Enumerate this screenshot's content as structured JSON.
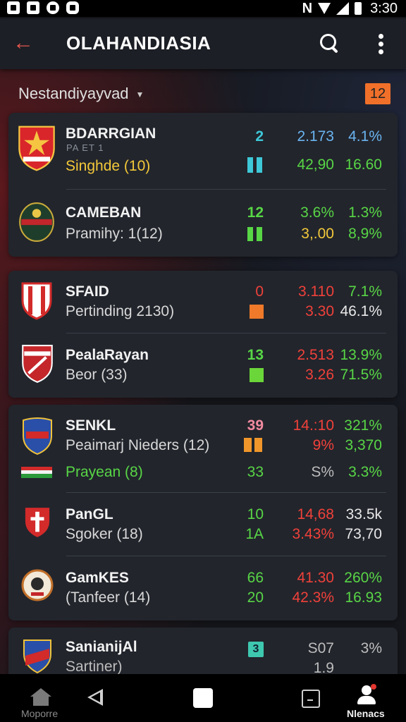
{
  "status_bar": {
    "time": "3:30",
    "carrier_glyph": "N",
    "icons": [
      "notification-icon",
      "file-icon",
      "voicemail-icon",
      "sim-icon",
      "signal-icon",
      "wifi-icon",
      "battery-icon"
    ]
  },
  "app_bar": {
    "title": "OLAHANDIASIA",
    "back_icon": "arrow-left-icon",
    "search_icon": "search-icon",
    "menu_icon": "more-vert-icon"
  },
  "filter": {
    "label": "Nestandiyayvad",
    "badge": "12"
  },
  "colors": {
    "accent": "#e4554e",
    "badge": "#f0702a",
    "green": "#58d646",
    "red": "#f0413a",
    "cyan": "#3ec8d8"
  },
  "cards": [
    {
      "rows": [
        {
          "name": "BDARRGIAN",
          "faint": "PA ET 1",
          "sub": "Singhde (10)",
          "v1a": "2",
          "v1b_marker": "cyan-bars",
          "v2a": "2.173",
          "v2b": "42,90",
          "v3a": "4.1%",
          "v3b": "16.60"
        },
        {
          "name": "CAMEBAN",
          "sub": "Pramihy: 1(12)",
          "v1a": "12",
          "v1b_marker": "green-bars",
          "v2a": "3.6%",
          "v2b": "3,.00",
          "v3a": "1.3%",
          "v3b": "8,9%"
        }
      ]
    },
    {
      "rows": [
        {
          "name": "SFAID",
          "sub": "Pertinding 2130)",
          "v1a": "0",
          "v1b_marker": "orange-square",
          "v2a": "3.110",
          "v2b": "3.30",
          "v3a": "7.1%",
          "v3b": "46.1%"
        },
        {
          "name": "PealaRayan",
          "sub": "Beor (33)",
          "v1a": "13",
          "v1b_marker": "green-square",
          "v2a": "2.513",
          "v2b": "3.26",
          "v3a": "13.9%",
          "v3b": "71.5%"
        }
      ]
    },
    {
      "rows": [
        {
          "name": "SENKL",
          "sub": "Peaimarj Nieders (12)",
          "v1a": "39",
          "v1b_marker": "orange-bars",
          "v2a": "14.:10",
          "v2b": "9%",
          "v3a": "321%",
          "v3b": "3,370"
        },
        {
          "name": "",
          "sub": "Prayean (8)",
          "v1a": "33",
          "v2a": "S%",
          "v3a": "3.3%"
        },
        {
          "name": "PanGL",
          "sub": "Sgoker (18)",
          "v1a": "10",
          "v1b": "1A",
          "v2a": "14,68",
          "v2b": "3.43%",
          "v3a": "33.5k",
          "v3b": "73,70"
        },
        {
          "name": "GamKES",
          "sub": "(Tanfeer (14)",
          "v1a": "66",
          "v1b": "20",
          "v2a": "41.30",
          "v2b": "42.3%",
          "v3a": "260%",
          "v3b": "16.93"
        }
      ]
    },
    {
      "rows": [
        {
          "name": "SanianijAl",
          "sub": "Sartiner)",
          "v1_marker": "cyan-square",
          "v1a": "3",
          "v2a": "S07",
          "v2b": "1.9",
          "v3a": "3%"
        }
      ]
    }
  ],
  "bottom_nav": {
    "items": [
      {
        "label": "Moporre",
        "icon": "home-icon"
      },
      {
        "label": "",
        "icon": "back-triangle-icon"
      },
      {
        "label": "",
        "icon": "home-square-icon"
      },
      {
        "label": "",
        "icon": "recent-apps-icon"
      },
      {
        "label": "Nlenacs",
        "icon": "person-icon"
      }
    ]
  }
}
